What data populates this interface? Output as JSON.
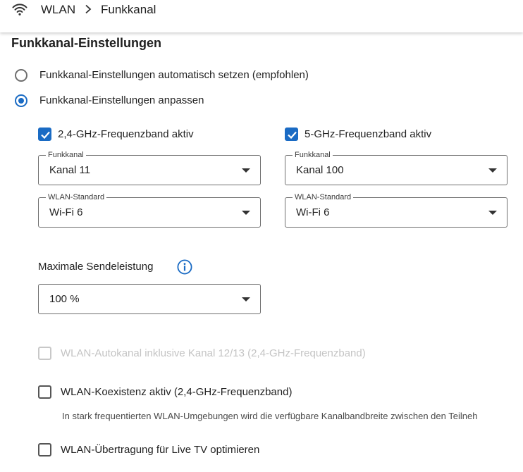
{
  "breadcrumb": {
    "icon": "wifi-icon",
    "items": [
      "WLAN",
      "Funkkanal"
    ]
  },
  "section_title": "Funkkanal-Einstellungen",
  "mode": {
    "auto_label": "Funkkanal-Einstellungen automatisch setzen (empfohlen)",
    "auto_selected": false,
    "custom_label": "Funkkanal-Einstellungen anpassen",
    "custom_selected": true
  },
  "band24": {
    "label": "2,4-GHz-Frequenzband aktiv",
    "checked": true,
    "channel_legend": "Funkkanal",
    "channel_value": "Kanal 11",
    "standard_legend": "WLAN-Standard",
    "standard_value": "Wi-Fi 6"
  },
  "band5": {
    "label": "5-GHz-Frequenzband aktiv",
    "checked": true,
    "channel_legend": "Funkkanal",
    "channel_value": "Kanal 100",
    "standard_legend": "WLAN-Standard",
    "standard_value": "Wi-Fi 6"
  },
  "power": {
    "label": "Maximale Sendeleistung",
    "value": "100 %"
  },
  "options": {
    "autochannel_label": "WLAN-Autokanal inklusive Kanal 12/13 (2,4-GHz-Frequenzband)",
    "autochannel_disabled": true,
    "coexistence_label": "WLAN-Koexistenz aktiv (2,4-GHz-Frequenzband)",
    "coexistence_hint": "In stark frequentierten WLAN-Umgebungen wird die verfügbare Kanalbandbreite zwischen den Teilneh",
    "livetv_label": "WLAN-Übertragung für Live TV optimieren"
  },
  "colors": {
    "accent": "#1a6bc4",
    "disabled_text": "#c4c4c4"
  }
}
